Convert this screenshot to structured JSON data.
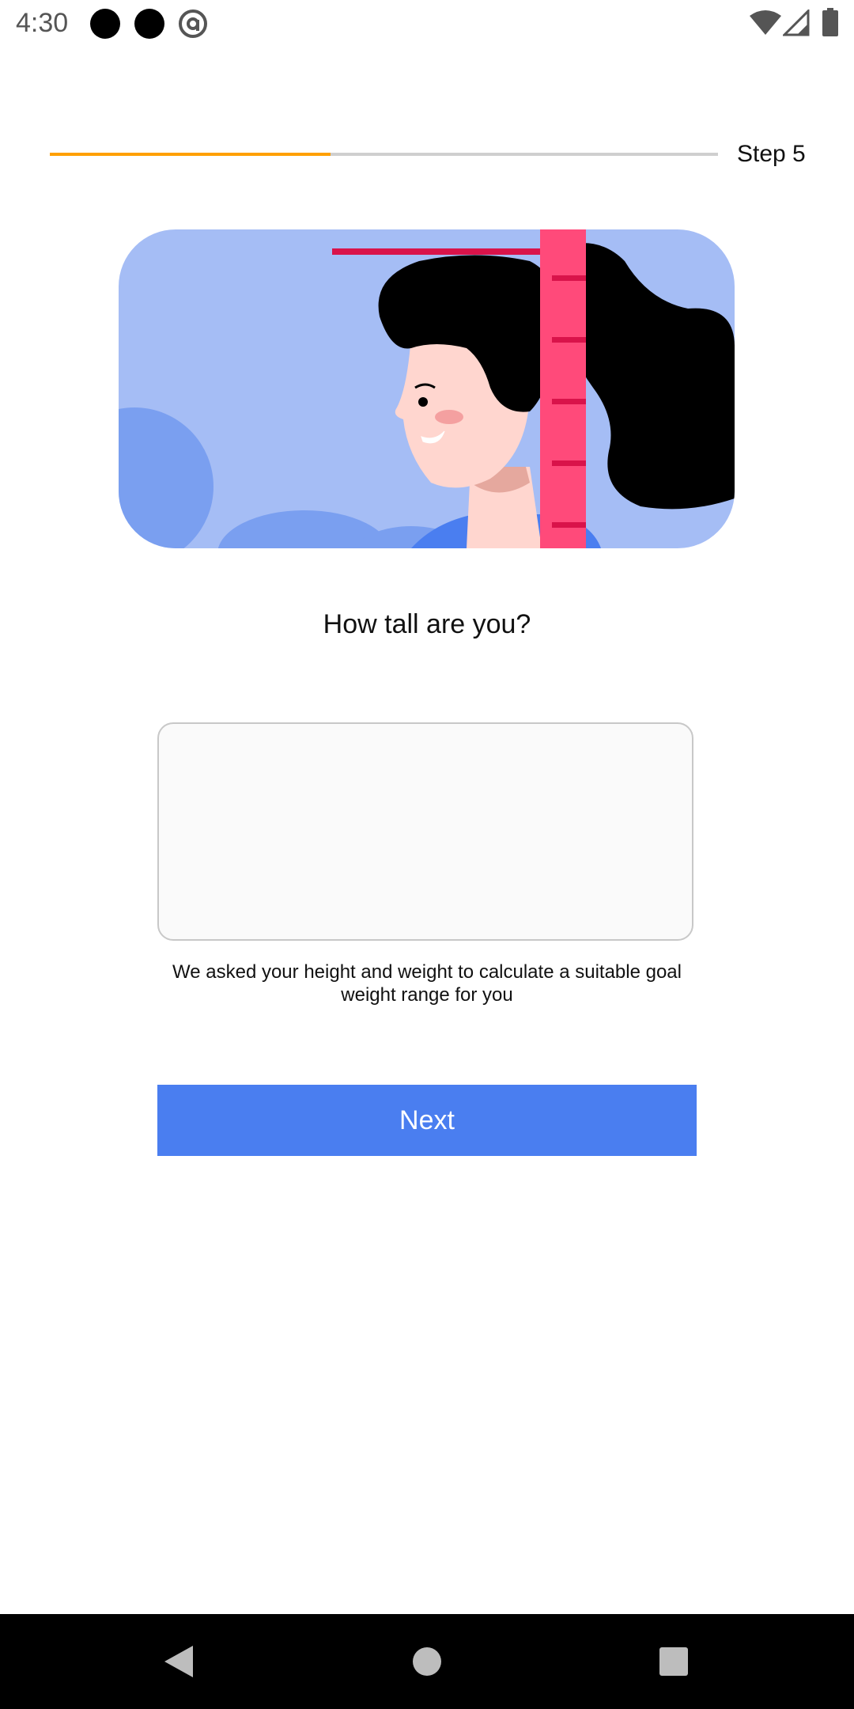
{
  "status_bar": {
    "time": "4:30",
    "icons": [
      "notification-dot-icon",
      "notification-dot-icon",
      "at-sign-icon",
      "wifi-icon",
      "cell-signal-icon",
      "battery-icon"
    ]
  },
  "progress": {
    "value": 0.42,
    "fill_color": "#ffa000",
    "track_color": "#cfcfcf",
    "step_label": "Step 5"
  },
  "illustration": {
    "icon": "height-measurement-illustration",
    "background_color": "#a5bdf5",
    "ruler_color": "#ff4a7a"
  },
  "question": "How tall are you?",
  "height_input": {
    "value": "",
    "placeholder": ""
  },
  "helper_text": "We asked your height and weight to calculate a suitable goal weight range for you",
  "next_button": {
    "label": "Next",
    "color": "#4a7ef0"
  },
  "nav_bar": {
    "icons": [
      "back-icon",
      "home-icon",
      "recents-icon"
    ]
  }
}
